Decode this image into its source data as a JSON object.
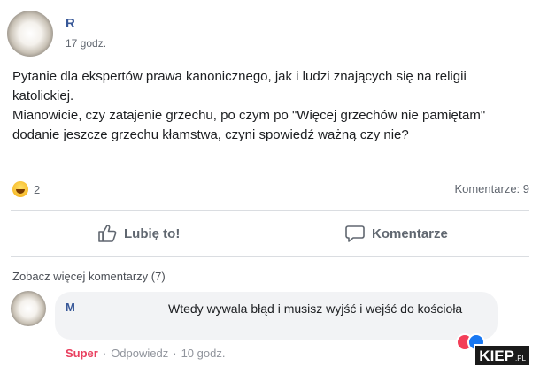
{
  "post": {
    "author": "R",
    "time": "17 godz.",
    "body_lines": [
      "Pytanie dla ekspertów prawa kanonicznego, jak i ludzi znających się na religii katolickiej.",
      "Mianowicie, czy zatajenie grzechu, po czym po \"Więcej grzechów nie pamiętam\" dodanie jeszcze grzechu kłamstwa, czyni spowiedź ważną czy nie?"
    ],
    "reaction_icon": "haha-emoji-icon",
    "reaction_count": "2",
    "comment_count": "Komentarze: 9",
    "like_label": "Lubię to!",
    "comment_label": "Komentarze"
  },
  "comments": {
    "more_label": "Zobacz więcej komentarzy (7)",
    "items": [
      {
        "author": "M",
        "text": "Wtedy wywala błąd i musisz wyjść i wejść do kościoła",
        "reaction_label": "Super",
        "reply_label": "Odpowiedz",
        "time": "10 godz."
      }
    ]
  },
  "watermark": {
    "main": "KIEP",
    "suffix": ".PL"
  },
  "colors": {
    "link": "#385898",
    "muted": "#616770",
    "super": "#e9405f",
    "bubble": "#f2f3f5"
  }
}
